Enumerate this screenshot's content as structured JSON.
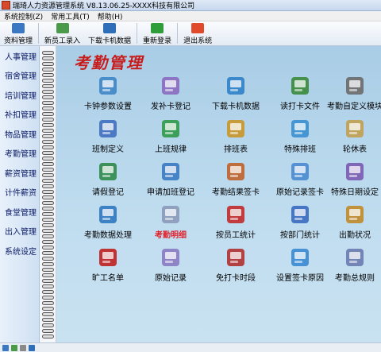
{
  "window": {
    "title": "瑞琦人力资源管理系统 V8.13.06.25-XXXX科技有限公司"
  },
  "menu": [
    "系统控制(Z)",
    "常用工具(T)",
    "帮助(H)"
  ],
  "toolbar": {
    "items": [
      {
        "label": "资料管理",
        "icon": "folder-user-icon",
        "color": "#3a78c4"
      },
      {
        "label": "新员工录入",
        "icon": "add-user-icon",
        "color": "#4a9a4a"
      },
      {
        "label": "下载卡机数据",
        "icon": "download-icon",
        "color": "#2f6fba"
      },
      {
        "label": "重新登录",
        "icon": "relogin-icon",
        "color": "#2f9e3a"
      },
      {
        "label": "退出系统",
        "icon": "exit-icon",
        "color": "#e04a2a"
      }
    ]
  },
  "sidebar": {
    "items": [
      "人事管理",
      "宿舍管理",
      "培训管理",
      "补扣管理",
      "物品管理",
      "考勤管理",
      "薪资管理",
      "计件薪资",
      "食堂管理",
      "出入管理",
      "系统设定"
    ]
  },
  "main": {
    "title": "考勤管理",
    "rows": [
      [
        {
          "label": "卡钟参数设置",
          "icon": "clock-settings-icon",
          "color": "#3e86c8"
        },
        {
          "label": "发补卡登记",
          "icon": "card-issue-icon",
          "color": "#8a6ac0"
        },
        {
          "label": "下载卡机数据",
          "icon": "download-icon",
          "color": "#2f7fc8"
        },
        {
          "label": "读打卡文件",
          "icon": "read-file-icon",
          "color": "#3a8a3a"
        },
        {
          "label": "考勤自定义模块",
          "icon": "custom-module-icon",
          "color": "#6a6a6a"
        }
      ],
      [
        {
          "label": "班制定义",
          "icon": "shift-define-icon",
          "color": "#3f6fc0"
        },
        {
          "label": "上班规律",
          "icon": "work-pattern-icon",
          "color": "#2f9a4a"
        },
        {
          "label": "排班表",
          "icon": "schedule-icon",
          "color": "#c8962a"
        },
        {
          "label": "特殊排班",
          "icon": "special-schedule-icon",
          "color": "#3a8fd0"
        },
        {
          "label": "轮休表",
          "icon": "rotation-icon",
          "color": "#c0a050"
        }
      ],
      [
        {
          "label": "请假登记",
          "icon": "leave-icon",
          "color": "#2f8a4a"
        },
        {
          "label": "申请加班登记",
          "icon": "overtime-icon",
          "color": "#3a7ac0"
        },
        {
          "label": "考勤结果签卡",
          "icon": "result-sign-icon",
          "color": "#c0602a"
        },
        {
          "label": "原始记录签卡",
          "icon": "record-sign-icon",
          "color": "#4a8ad0"
        },
        {
          "label": "特殊日期设定",
          "icon": "special-date-icon",
          "color": "#7a5ab0"
        }
      ],
      [
        {
          "label": "考勤数据处理",
          "icon": "data-process-icon",
          "color": "#2f78c0"
        },
        {
          "label": "考勤明细",
          "icon": "detail-icon",
          "color": "#8a9ab8",
          "active": true
        },
        {
          "label": "按员工统计",
          "icon": "employee-stats-icon",
          "color": "#c02a2a"
        },
        {
          "label": "按部门统计",
          "icon": "department-stats-icon",
          "color": "#3a6ac0"
        },
        {
          "label": "出勤状况",
          "icon": "attendance-status-icon",
          "color": "#c08a2a"
        }
      ],
      [
        {
          "label": "旷工名单",
          "icon": "absentee-icon",
          "color": "#c02020"
        },
        {
          "label": "原始记录",
          "icon": "original-record-icon",
          "color": "#8a7ac0"
        },
        {
          "label": "免打卡时段",
          "icon": "no-punch-icon",
          "color": "#b03030"
        },
        {
          "label": "设置签卡原因",
          "icon": "sign-reason-icon",
          "color": "#3a8ad0"
        },
        {
          "label": "考勤总规则",
          "icon": "rules-book-icon",
          "color": "#6a7ab0"
        }
      ]
    ]
  },
  "status": {
    "icons": [
      "status-icon-1",
      "status-icon-2",
      "status-icon-3",
      "status-icon-4"
    ]
  },
  "colors": {
    "title": "#c81d1d",
    "active_label": "#e0202a",
    "content_bg": "#b4d4ea"
  }
}
